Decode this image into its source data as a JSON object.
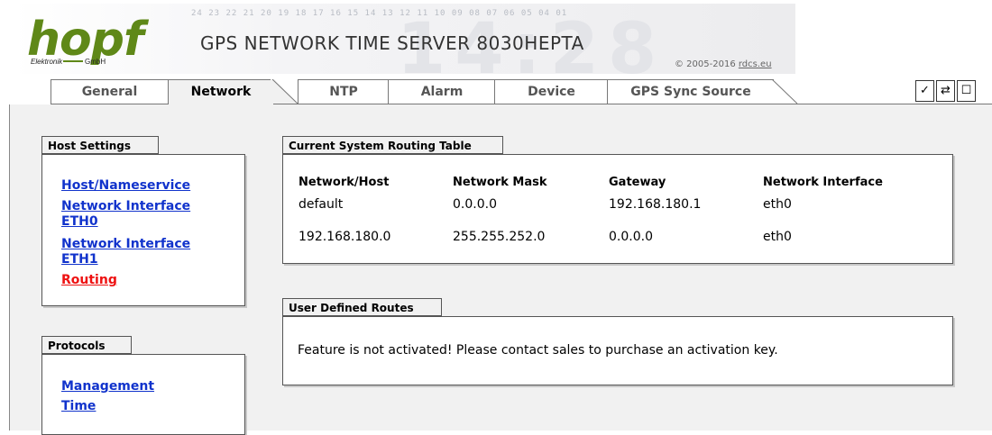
{
  "header": {
    "logo_brand": "hopf",
    "logo_company": "Elektronik",
    "logo_gmbh": "GmbH",
    "product_title": "GPS NETWORK TIME SERVER 8030HEPTA",
    "copyright_prefix": "© 2005-2016 ",
    "copyright_link": "rdcs.eu",
    "background_digits": "24 23 22 21 20 19 18 17 16 15 14 13 12 11 10 09 08 07 06 05 04 01",
    "background_clock": "14:28"
  },
  "tabs": [
    {
      "label": "General",
      "active": false
    },
    {
      "label": "Network",
      "active": true
    },
    {
      "label": "NTP",
      "active": false
    },
    {
      "label": "Alarm",
      "active": false
    },
    {
      "label": "Device",
      "active": false
    },
    {
      "label": "GPS Sync Source",
      "active": false
    }
  ],
  "toolbar_icons": [
    {
      "name": "check-icon",
      "glyph": "✓"
    },
    {
      "name": "refresh-icon",
      "glyph": "⇄"
    },
    {
      "name": "window-icon",
      "glyph": "☐"
    }
  ],
  "sidebar": {
    "host_settings": {
      "title": "Host Settings",
      "links": [
        {
          "label": "Host/Nameservice",
          "active": false
        },
        {
          "label": "Network Interface ETH0",
          "active": false
        },
        {
          "label": "Network Interface ETH1",
          "active": false
        },
        {
          "label": "Routing",
          "active": true
        }
      ]
    },
    "protocols": {
      "title": "Protocols",
      "links": [
        {
          "label": "Management",
          "active": false
        },
        {
          "label": "Time",
          "active": false
        }
      ]
    }
  },
  "routing_table": {
    "title": "Current System Routing Table",
    "columns": [
      "Network/Host",
      "Network Mask",
      "Gateway",
      "Network Interface"
    ],
    "rows": [
      [
        "default",
        "0.0.0.0",
        "192.168.180.1",
        "eth0"
      ],
      [
        "192.168.180.0",
        "255.255.252.0",
        "0.0.0.0",
        "eth0"
      ]
    ]
  },
  "user_routes": {
    "title": "User Defined Routes",
    "message": "Feature is not activated! Please contact sales to purchase an activation key."
  },
  "colors": {
    "logo_green": "#5f8818",
    "link_blue": "#1133cc",
    "link_active_red": "#ee1111",
    "panel_bg": "#f1f1f1"
  }
}
